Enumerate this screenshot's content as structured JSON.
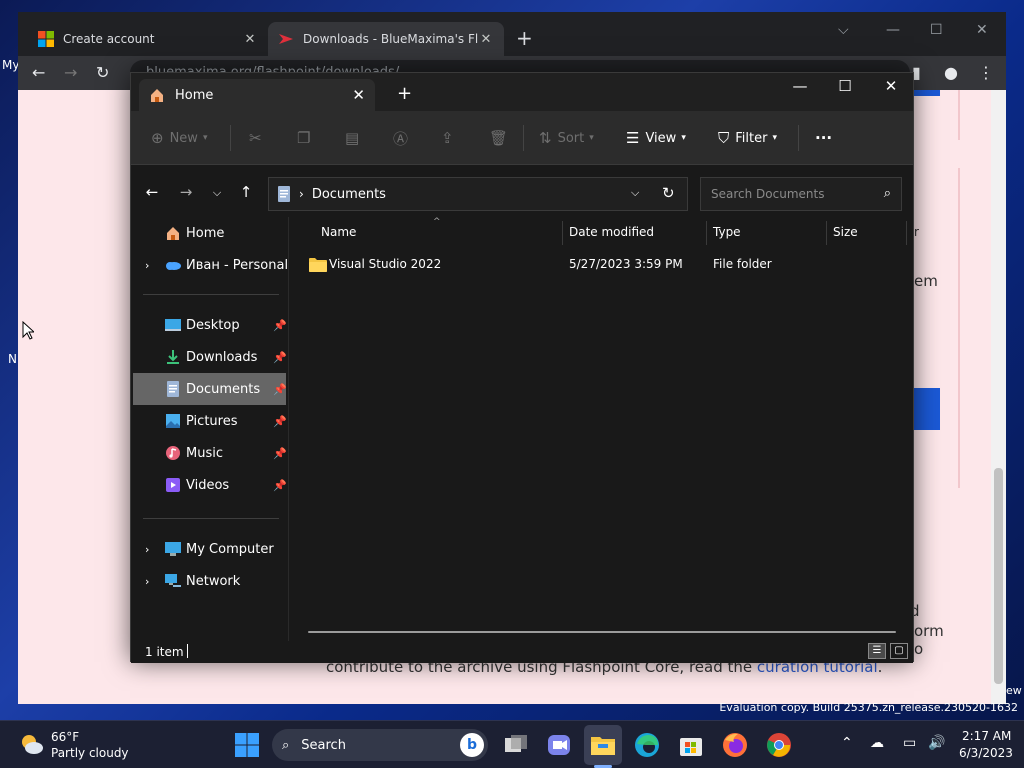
{
  "browser": {
    "tabs": [
      {
        "title": "Create account"
      },
      {
        "title": "Downloads - BlueMaxima's Flash"
      }
    ],
    "new_tab_symbol": "+",
    "url": "bluemaxima.org/flashpoint/downloads/",
    "page_text_main": "contribute to the archive using Flashpoint Core, read the ",
    "page_text_link": "curation tutorial",
    "page_text_end": ".",
    "page_frag_em": "em",
    "page_frag_d": "d",
    "page_frag_orm": "orm",
    "page_frag_o": "o",
    "page_frag_r": "r",
    "page_frag_ew": "ew"
  },
  "desktop": {
    "label_my": "My",
    "label_n": "N"
  },
  "explorer": {
    "tab_title": "Home",
    "commands": {
      "new": "New",
      "sort": "Sort",
      "view": "View",
      "filter": "Filter",
      "more": "···"
    },
    "breadcrumb": [
      "Documents"
    ],
    "search_placeholder": "Search Documents",
    "nav": {
      "home": "Home",
      "onedrive": "Иван - Personal",
      "desktop": "Desktop",
      "downloads": "Downloads",
      "documents": "Documents",
      "pictures": "Pictures",
      "music": "Music",
      "videos": "Videos",
      "my_computer": "My Computer",
      "network": "Network"
    },
    "columns": {
      "name": "Name",
      "date": "Date modified",
      "type": "Type",
      "size": "Size"
    },
    "files": [
      {
        "name": "Visual Studio 2022",
        "date": "5/27/2023 3:59 PM",
        "type": "File folder",
        "size": ""
      }
    ],
    "status": "1 item"
  },
  "watermark": "Evaluation copy. Build 25375.zn_release.230520-1632",
  "taskbar": {
    "weather_temp": "66°F",
    "weather_desc": "Partly cloudy",
    "search_label": "Search",
    "bing_letter": "b",
    "clock_time": "2:17 AM",
    "clock_date": "6/3/2023"
  },
  "colors": {
    "accent": "#1b59d6",
    "explorer_bg": "#191919",
    "selected_nav": "#666666",
    "page_bg": "#fde7ea"
  },
  "icons": [
    "microsoft-logo-icon",
    "flashpoint-icon",
    "home-icon",
    "onedrive-cloud-icon",
    "desktop-icon",
    "downloads-icon",
    "documents-icon",
    "pictures-icon",
    "music-icon",
    "videos-icon",
    "computer-icon",
    "network-icon",
    "folder-icon",
    "pin-icon",
    "search-icon",
    "weather-icon",
    "windows-start-icon",
    "task-view-icon",
    "teams-icon",
    "file-explorer-icon",
    "edge-icon",
    "store-icon",
    "firefox-icon",
    "chrome-icon"
  ]
}
